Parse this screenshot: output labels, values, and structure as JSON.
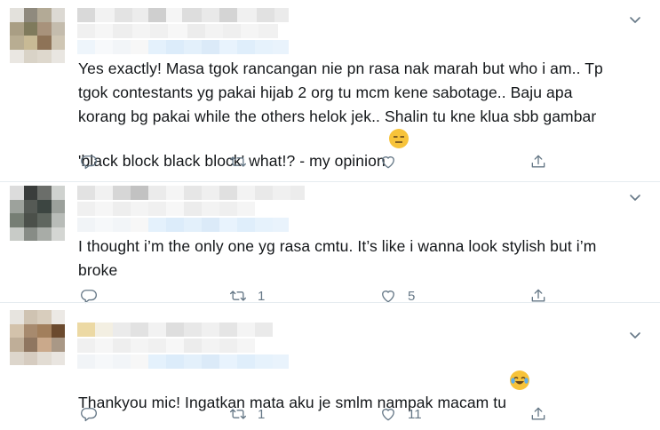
{
  "tweets": [
    {
      "text": "Yes exactly! Masa tgok rancangan nie pn rasa nak marah but who i am.. Tp\ntgok contestants yg pakai hijab 2 org tu mcm kene sabotage.. Baju apa\nkorang bg pakai while the others helok jek.. Shalin tu kne klua sbb gambar\n'black block black block' what!? - my opinion",
      "emoji": "expressionless-face-emoji",
      "replies": "",
      "retweets": "",
      "likes": ""
    },
    {
      "text": "I thought i’m the only one yg rasa cmtu. It’s like i wanna look stylish but i’m\nbroke",
      "emoji": "",
      "replies": "",
      "retweets": "1",
      "likes": "5"
    },
    {
      "text": "Thankyou mic! Ingatkan mata aku je smlm nampak macam tu",
      "emoji": "face-with-tears-of-joy-emoji",
      "replies": "",
      "retweets": "1",
      "likes": "11"
    }
  ],
  "icons": {
    "reply": "reply-icon",
    "retweet": "retweet-icon",
    "like": "like-icon",
    "share": "share-icon",
    "more": "chevron-down-icon"
  },
  "colors": {
    "text": "#14171a",
    "secondary": "#657786",
    "divider": "#e6ecf0",
    "blurred_handle": "#e8f5fd"
  }
}
